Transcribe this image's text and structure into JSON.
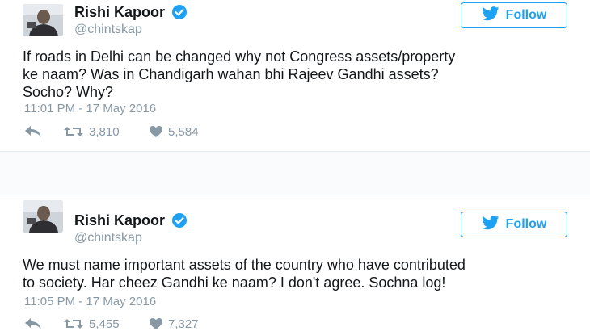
{
  "colors": {
    "accent": "#1da1f2",
    "text": "#14171a",
    "muted": "#8899a6",
    "divider": "#e6ecf0"
  },
  "tweets": [
    {
      "display_name": "Rishi Kapoor",
      "handle": "@chintskap",
      "verified": true,
      "follow_label": "Follow",
      "text": "If roads in Delhi can be changed why not Congress assets/property\nke naam? Was in Chandigarh wahan bhi Rajeev Gandhi assets?\nSocho? Why?",
      "timestamp": "11:01 PM - 17 May 2016",
      "retweets": "3,810",
      "likes": "5,584"
    },
    {
      "display_name": "Rishi Kapoor",
      "handle": "@chintskap",
      "verified": true,
      "follow_label": "Follow",
      "text": "We must name important assets of the country who have contributed\nto society. Har cheez Gandhi ke naam? I don't agree. Sochna log!",
      "timestamp": "11:05 PM - 17 May 2016",
      "retweets": "5,455",
      "likes": "7,327"
    }
  ],
  "icons": {
    "avatar": "avatar-photo",
    "verified": "verified-badge-icon",
    "follow": "twitter-bird-icon",
    "reply": "reply-icon",
    "retweet": "retweet-icon",
    "like": "heart-icon"
  }
}
